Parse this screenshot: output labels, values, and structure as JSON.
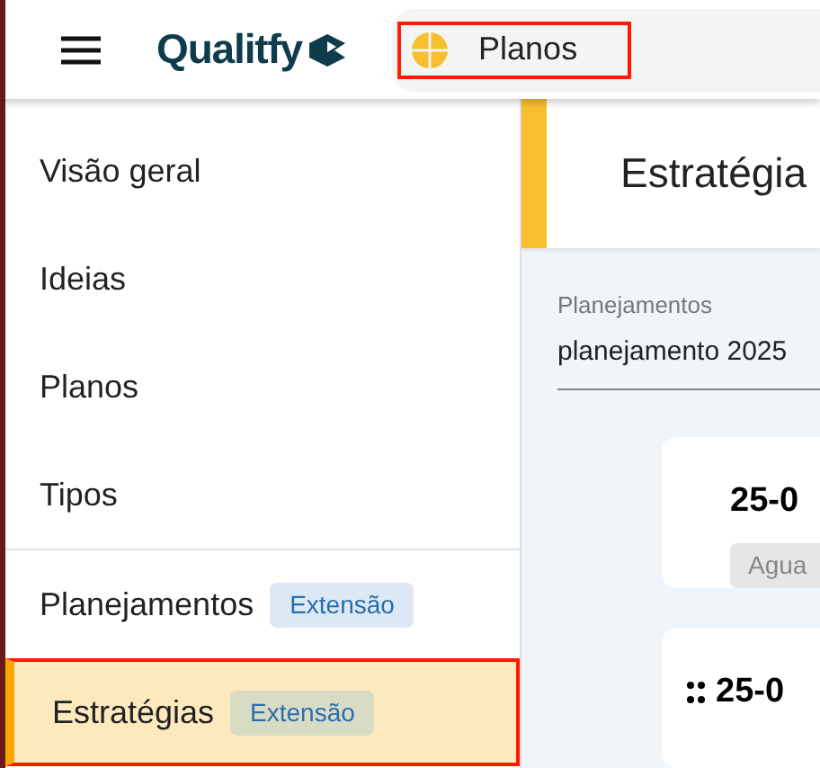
{
  "header": {
    "logo": "Qualitfy",
    "module": "Planos"
  },
  "sidebar": {
    "items": [
      {
        "label": "Visão geral",
        "selected": false
      },
      {
        "label": "Ideias",
        "selected": false
      },
      {
        "label": "Planos",
        "selected": false
      },
      {
        "label": "Tipos",
        "selected": false
      }
    ],
    "extension_items": [
      {
        "label": "Planejamentos",
        "badge": "Extensão",
        "selected": false
      },
      {
        "label": "Estratégias",
        "badge": "Extensão",
        "selected": true
      }
    ]
  },
  "page": {
    "title": "Estratégia",
    "filter": {
      "label": "Planejamentos",
      "value": "planejamento 2025"
    },
    "cards": [
      {
        "title": "25-0",
        "status": "Agua",
        "draggable": false
      },
      {
        "title": "25-0",
        "draggable": true
      }
    ]
  }
}
